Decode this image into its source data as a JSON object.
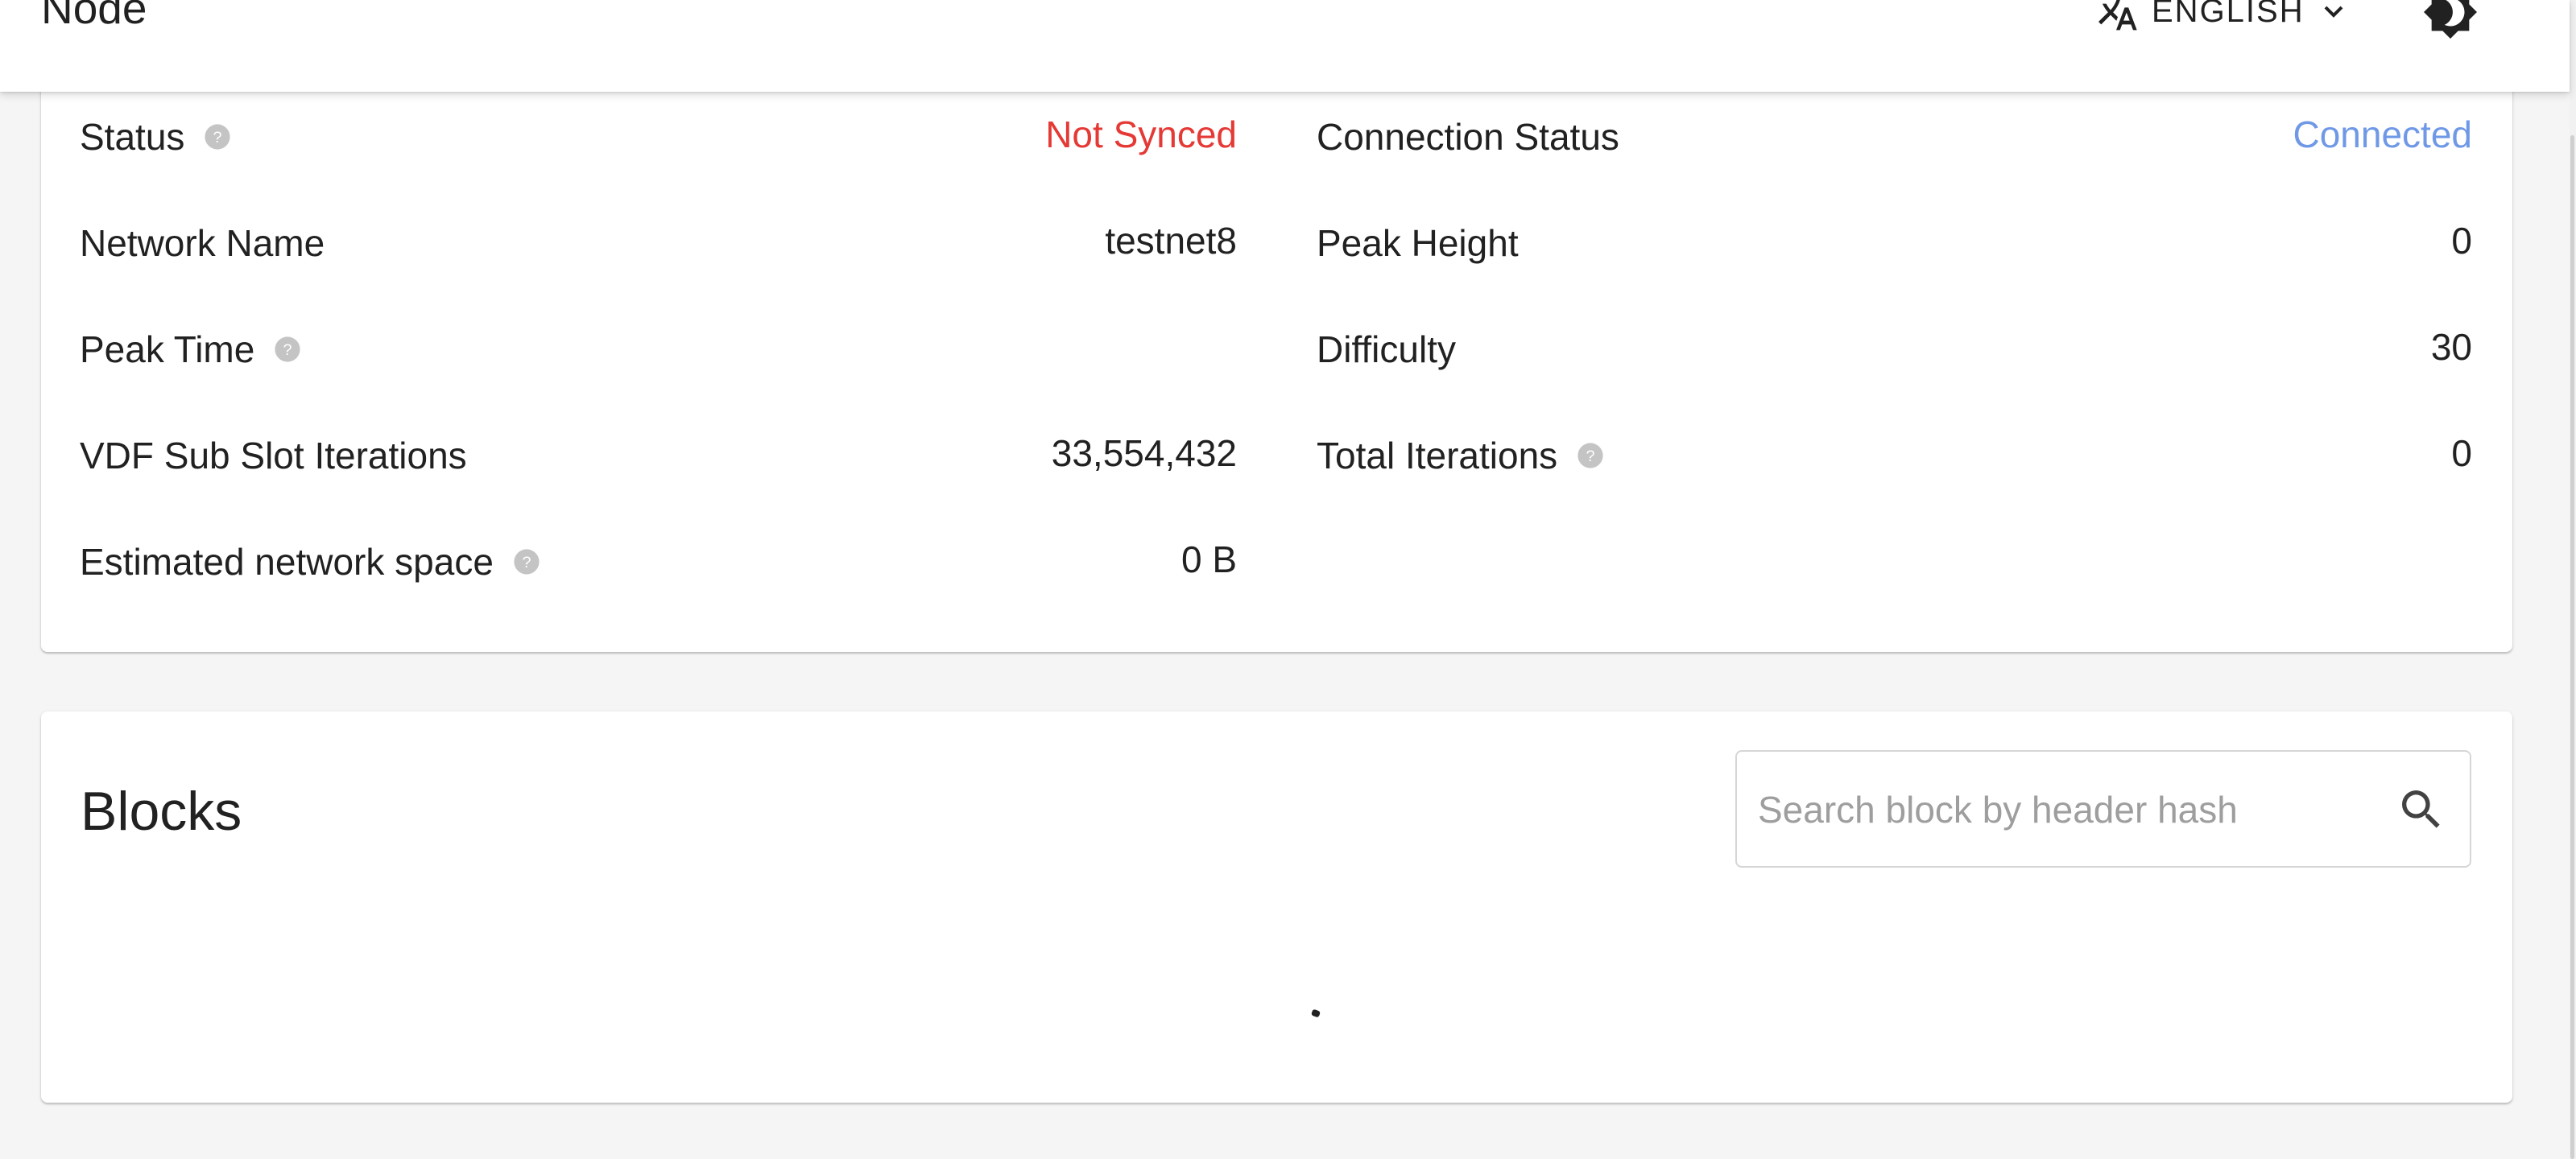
{
  "appbar": {
    "title": "Node",
    "language_label": "ENGLISH",
    "icons": {
      "translate": "translate-icon",
      "dropdown": "chevron-down-icon",
      "theme": "dark-mode-icon"
    }
  },
  "info": {
    "left": [
      {
        "label": "Status",
        "value": "Not Synced",
        "help": true,
        "status_color": "#e53935"
      },
      {
        "label": "Network Name",
        "value": "testnet8",
        "help": false
      },
      {
        "label": "Peak Time",
        "value": "",
        "help": true
      },
      {
        "label": "VDF Sub Slot Iterations",
        "value": "33,554,432",
        "help": false
      },
      {
        "label": "Estimated network space",
        "value": "0 B",
        "help": true
      }
    ],
    "right": [
      {
        "label": "Connection Status",
        "value": "Connected",
        "help": false,
        "status_color": "#6f98e6"
      },
      {
        "label": "Peak Height",
        "value": "0",
        "help": false
      },
      {
        "label": "Difficulty",
        "value": "30",
        "help": false
      },
      {
        "label": "Total Iterations",
        "value": "0",
        "help": true
      }
    ]
  },
  "blocks": {
    "title": "Blocks",
    "search": {
      "placeholder": "Search block by header hash",
      "value": ""
    }
  }
}
